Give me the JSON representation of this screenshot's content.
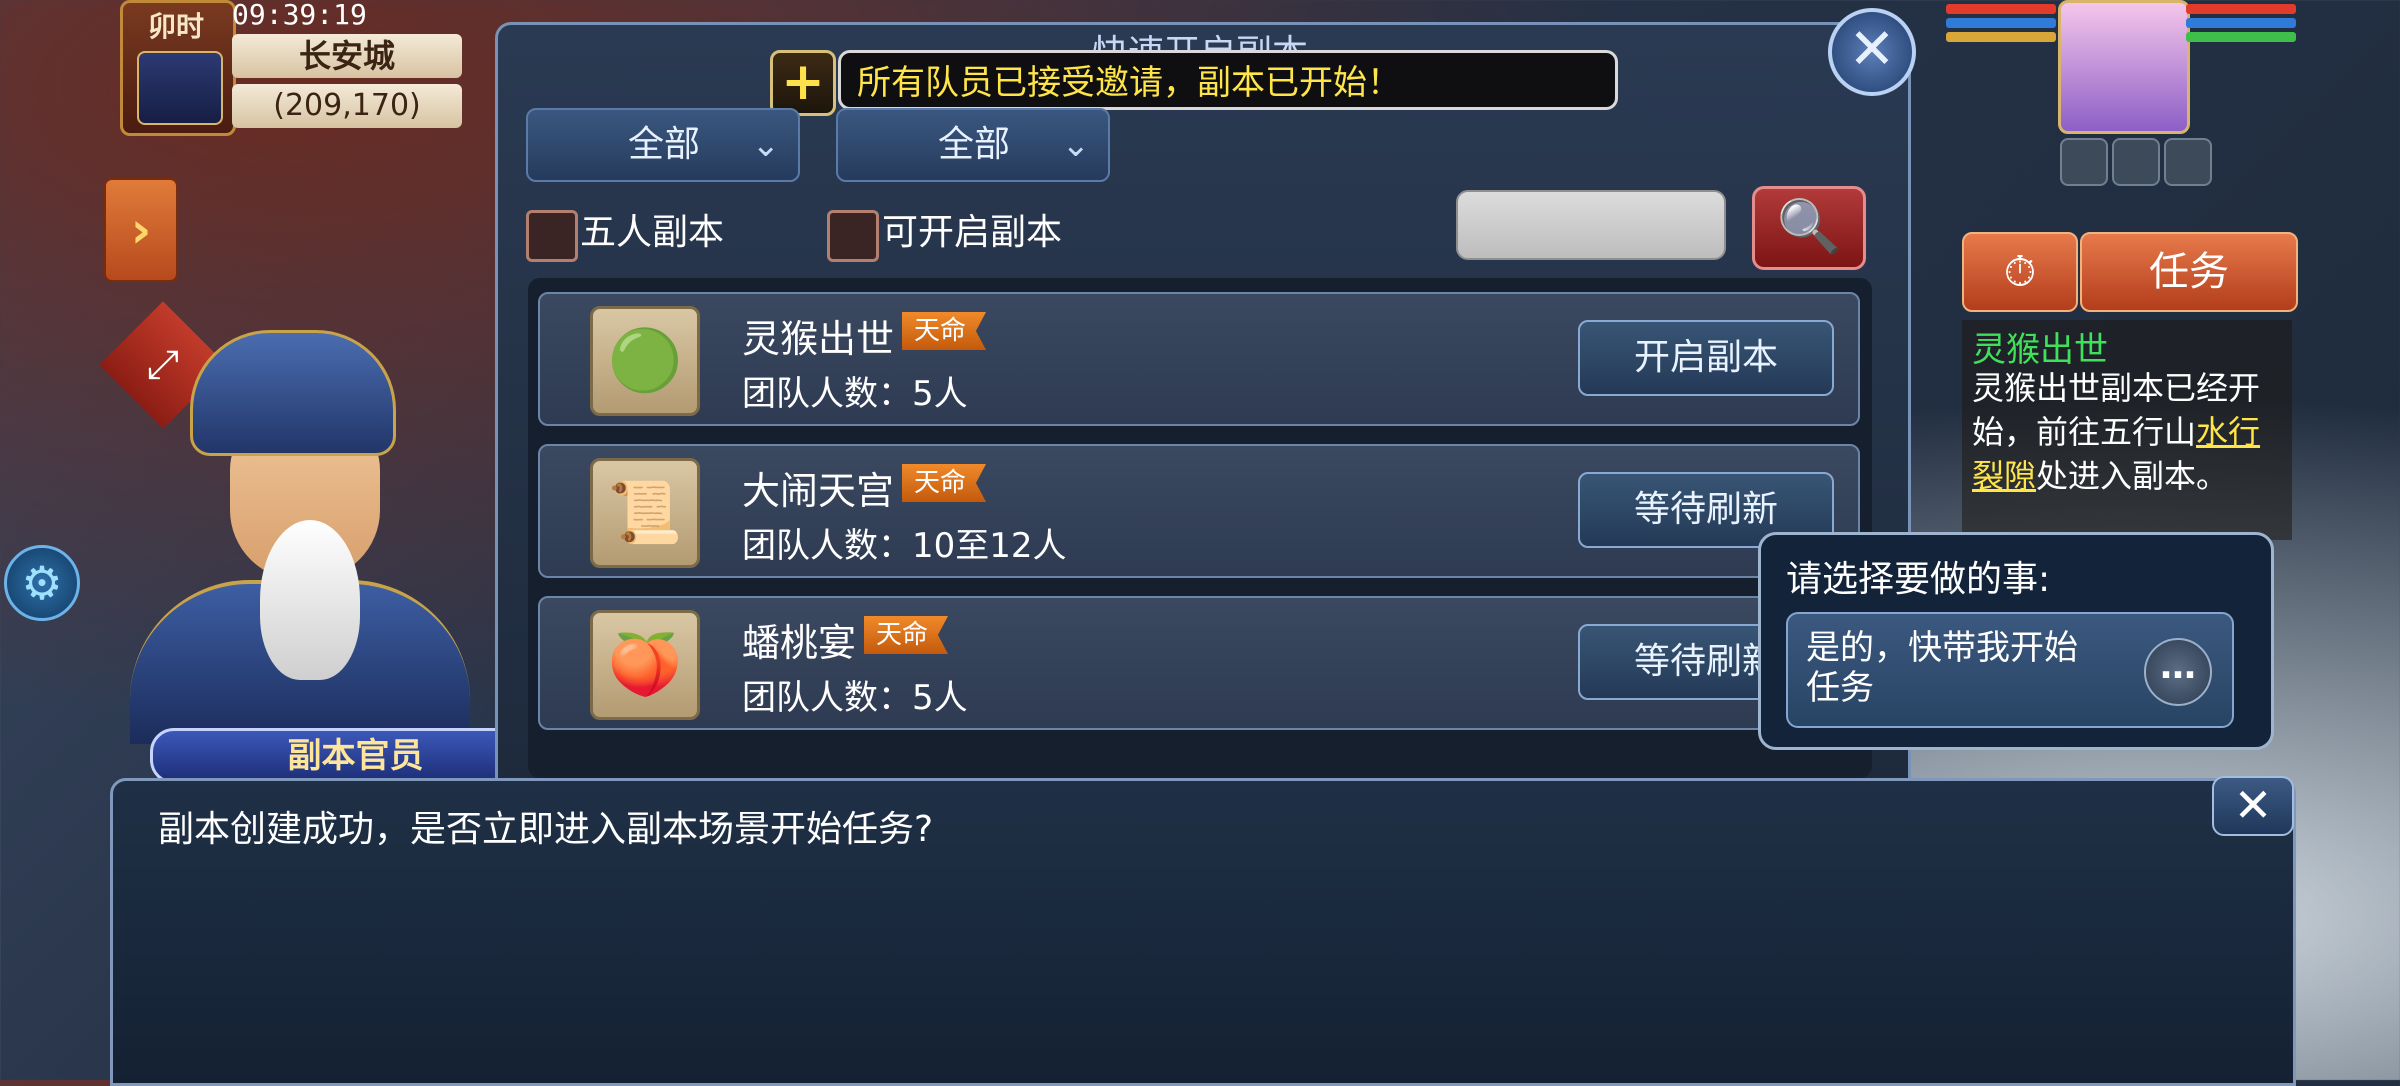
{
  "hud": {
    "shichen": "卯时",
    "time": "09:39:19",
    "city": "长安城",
    "coords": "(209,170)"
  },
  "side": {
    "arrow_icon": "›",
    "expand_icon": "⤢",
    "settings_icon": "⚙"
  },
  "npc": {
    "name": "副本官员"
  },
  "panel": {
    "title": "快速开启副本",
    "close_icon": "✕",
    "notice_icon": "+",
    "notice_text": "所有队员已接受邀请，副本已开始！",
    "filters": {
      "dropdown1": "全部",
      "dropdown2": "全部",
      "chevron": "⌄",
      "checkbox1_label": "五人副本",
      "checkbox2_label": "可开启副本"
    },
    "search_icon": "🔍",
    "dungeons": [
      {
        "name": "灵猴出世",
        "badge": "天命",
        "team": "团队人数：5人",
        "action": "开启副本",
        "icon": "🟢"
      },
      {
        "name": "大闹天宫",
        "badge": "天命",
        "team": "团队人数：10至12人",
        "action": "等待刷新",
        "icon": "📜"
      },
      {
        "name": "蟠桃宴",
        "badge": "天命",
        "team": "团队人数：5人",
        "action": "等待刷新",
        "icon": "🍑"
      }
    ]
  },
  "right": {
    "quest_tab": "任务",
    "timer_icon": "⏱",
    "quest_title": "灵猴出世",
    "quest_line1": "灵猴出世副本已经开始，前往五行山",
    "quest_link": "水行裂隙",
    "quest_line2": "处进入副本。"
  },
  "choice": {
    "title": "请选择要做的事:",
    "option": "是的，快带我开始任务",
    "more_icon": "…"
  },
  "bottom": {
    "text": "副本创建成功，是否立即进入副本场景开始任务?",
    "close_icon": "✕"
  },
  "colors": {
    "notice_text": "#ffe54a",
    "quest_title": "#3fe15a",
    "badge": "#e0741c"
  }
}
